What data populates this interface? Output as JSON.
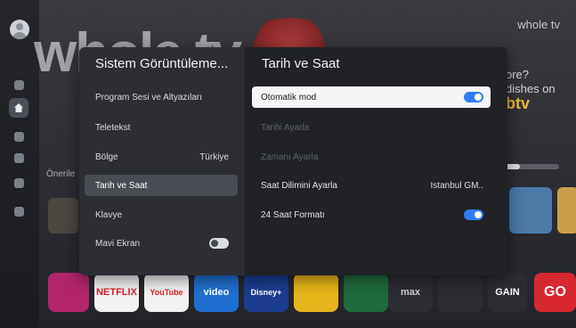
{
  "background": {
    "logo_big": "whole tv",
    "logo_small": "whole tv",
    "promo_lines": [
      "ore?",
      "dishes on"
    ],
    "promo_brand": "btv",
    "recommended_label": "Önerile",
    "apps": [
      "NETFLIX",
      "YouTube",
      "video",
      "Disney+",
      "",
      "",
      "max",
      "",
      "GAIN",
      "GO"
    ]
  },
  "left_panel": {
    "title": "Sistem Görüntüleme...",
    "items": [
      {
        "label": "Program Sesi ve Altyazıları",
        "value": ""
      },
      {
        "label": "Teletekst",
        "value": ""
      },
      {
        "label": "Bölge",
        "value": "Türkiye"
      },
      {
        "label": "Tarih ve Saat",
        "value": "",
        "selected": true
      },
      {
        "label": "Klavye",
        "value": ""
      },
      {
        "label": "Mavi Ekran",
        "value": "",
        "toggle": "off"
      }
    ]
  },
  "right_panel": {
    "title": "Tarih ve Saat",
    "items": [
      {
        "label": "Otomatik mod",
        "toggle": "on",
        "focused": true
      },
      {
        "label": "Tarihi Ayarla",
        "disabled": true
      },
      {
        "label": "Zamanı Ayarla",
        "disabled": true
      },
      {
        "label": "Saat Dilimini Ayarla",
        "value": "Istanbul GM.."
      },
      {
        "label": "24 Saat Formatı",
        "toggle": "on"
      }
    ]
  },
  "colors": {
    "accent": "#2f7df6",
    "panel_left": "#2c2e34",
    "panel_right": "#202226",
    "focus_row": "#f4f5f7"
  }
}
